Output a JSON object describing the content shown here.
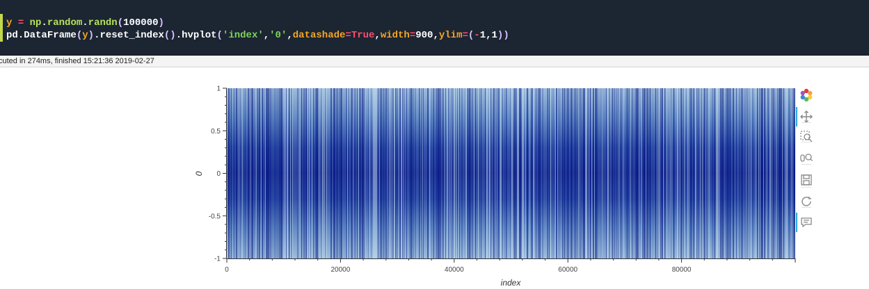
{
  "cell": {
    "code_line1": [
      {
        "cls": "tk-var",
        "t": "y"
      },
      {
        "cls": "tk-punc",
        "t": " "
      },
      {
        "cls": "tk-op",
        "t": "="
      },
      {
        "cls": "tk-punc",
        "t": " "
      },
      {
        "cls": "tk-mod",
        "t": "np"
      },
      {
        "cls": "tk-punc",
        "t": "."
      },
      {
        "cls": "tk-mod",
        "t": "random"
      },
      {
        "cls": "tk-punc",
        "t": "."
      },
      {
        "cls": "tk-mod",
        "t": "randn"
      },
      {
        "cls": "tk-paren",
        "t": "("
      },
      {
        "cls": "tk-num",
        "t": "100000"
      },
      {
        "cls": "tk-paren",
        "t": ")"
      }
    ],
    "code_line2": [
      {
        "cls": "tk-fn",
        "t": "pd"
      },
      {
        "cls": "tk-punc",
        "t": "."
      },
      {
        "cls": "tk-fn",
        "t": "DataFrame"
      },
      {
        "cls": "tk-paren",
        "t": "("
      },
      {
        "cls": "tk-var",
        "t": "y"
      },
      {
        "cls": "tk-paren",
        "t": ")"
      },
      {
        "cls": "tk-punc",
        "t": "."
      },
      {
        "cls": "tk-fn",
        "t": "reset_index"
      },
      {
        "cls": "tk-paren",
        "t": "()"
      },
      {
        "cls": "tk-punc",
        "t": "."
      },
      {
        "cls": "tk-fn",
        "t": "hvplot"
      },
      {
        "cls": "tk-paren",
        "t": "("
      },
      {
        "cls": "tk-str",
        "t": "'index'"
      },
      {
        "cls": "tk-punc",
        "t": ","
      },
      {
        "cls": "tk-str",
        "t": "'0'"
      },
      {
        "cls": "tk-punc",
        "t": ","
      },
      {
        "cls": "tk-param",
        "t": "datashade"
      },
      {
        "cls": "tk-op",
        "t": "="
      },
      {
        "cls": "tk-kw",
        "t": "True"
      },
      {
        "cls": "tk-punc",
        "t": ","
      },
      {
        "cls": "tk-param",
        "t": "width"
      },
      {
        "cls": "tk-op",
        "t": "="
      },
      {
        "cls": "tk-num",
        "t": "900"
      },
      {
        "cls": "tk-punc",
        "t": ","
      },
      {
        "cls": "tk-param",
        "t": "ylim"
      },
      {
        "cls": "tk-op",
        "t": "="
      },
      {
        "cls": "tk-paren",
        "t": "("
      },
      {
        "cls": "tk-op",
        "t": "-"
      },
      {
        "cls": "tk-num",
        "t": "1"
      },
      {
        "cls": "tk-punc",
        "t": ","
      },
      {
        "cls": "tk-num",
        "t": "1"
      },
      {
        "cls": "tk-paren",
        "t": "))"
      }
    ]
  },
  "status": {
    "text": "cuted in 274ms, finished 15:21:36 2019-02-27"
  },
  "chart_data": {
    "type": "line",
    "title": "",
    "xlabel": "index",
    "ylabel": "0",
    "xlim": [
      0,
      100000
    ],
    "ylim": [
      -1,
      1
    ],
    "xticks": [
      0,
      20000,
      40000,
      60000,
      80000
    ],
    "xtick_labels": [
      "0",
      "20000",
      "40000",
      "60000",
      "80000"
    ],
    "yticks": [
      1,
      0.5,
      0,
      -0.5,
      -1
    ],
    "ytick_labels": [
      "1",
      "0.5",
      "0",
      "-0.5",
      "-1"
    ],
    "series": [
      {
        "values_description_points": 100000
      }
    ],
    "colors": {
      "background_band": "#a9c8e0",
      "dense": "#0d1f8c",
      "mid": "#3c67b5"
    }
  },
  "toolbar": {
    "items": [
      {
        "name": "bokeh-logo-icon",
        "active": false
      },
      {
        "name": "pan-icon",
        "active": true
      },
      {
        "name": "box-zoom-icon",
        "active": false
      },
      {
        "name": "wheel-zoom-icon",
        "active": false
      },
      {
        "name": "save-icon",
        "active": false
      },
      {
        "name": "reset-icon",
        "active": false
      },
      {
        "name": "hover-icon",
        "active": true
      }
    ]
  }
}
